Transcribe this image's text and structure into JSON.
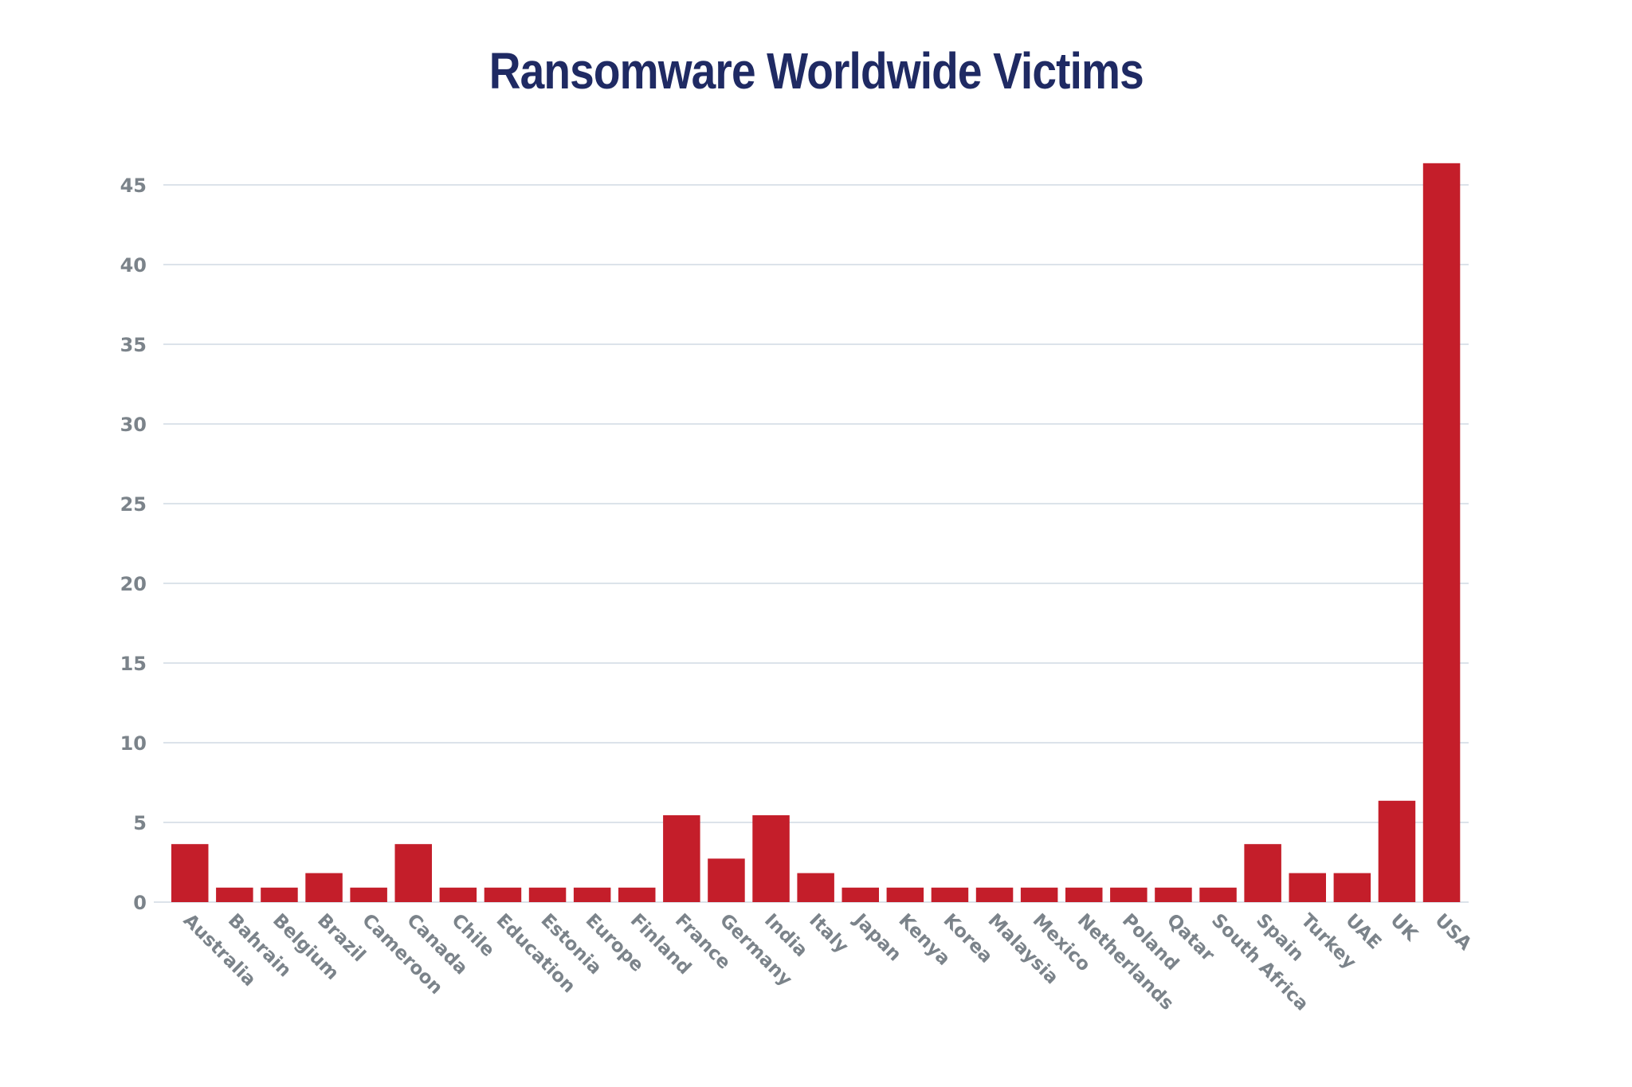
{
  "chart_data": {
    "type": "bar",
    "title": "Ransomware Worldwide Victims",
    "xlabel": "",
    "ylabel": "",
    "ylim": [
      0,
      45
    ],
    "yticks": [
      0,
      5,
      10,
      15,
      20,
      25,
      30,
      35,
      40,
      45
    ],
    "grid": true,
    "legend": "none",
    "bar_color": "#C41E2A",
    "title_color": "#1F2A63",
    "tick_color": "#7B838A",
    "grid_color": "#DCE3EA",
    "categories": [
      "Australia",
      "Bahrain",
      "Belgium",
      "Brazil",
      "Cameroon",
      "Canada",
      "Chile",
      "Education",
      "Estonia",
      "Europe",
      "Finland",
      "France",
      "Germany",
      "India",
      "Italy",
      "Japan",
      "Kenya",
      "Korea",
      "Malaysia",
      "Mexico",
      "Netherlands",
      "Poland",
      "Qatar",
      "South Africa",
      "Spain",
      "Turkey",
      "UAE",
      "UK",
      "USA"
    ],
    "values": [
      3.64,
      0.91,
      0.91,
      1.82,
      0.91,
      3.64,
      0.91,
      0.91,
      0.91,
      0.91,
      0.91,
      5.45,
      2.73,
      5.45,
      1.82,
      0.91,
      0.91,
      0.91,
      0.91,
      0.91,
      0.91,
      0.91,
      0.91,
      0.91,
      3.64,
      1.82,
      1.82,
      6.36,
      46.36
    ]
  }
}
